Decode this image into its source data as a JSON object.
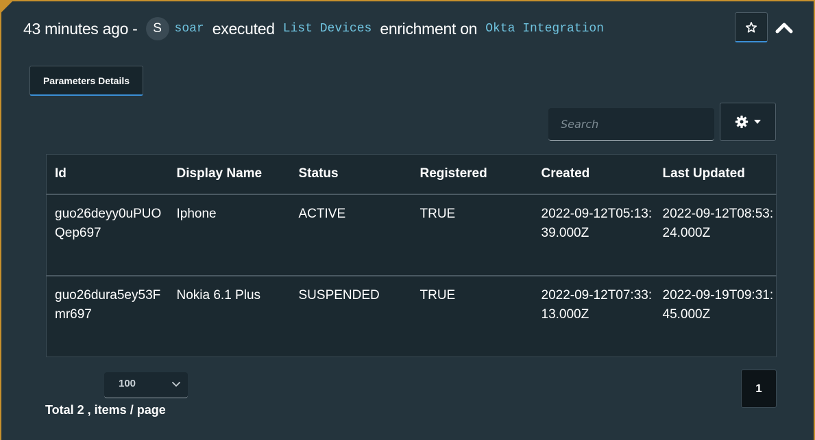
{
  "header": {
    "time_ago": "43 minutes ago -",
    "avatar_initial": "S",
    "user": "soar",
    "verb": "executed",
    "action": "List Devices",
    "middle": "enrichment on",
    "integration": "Okta Integration"
  },
  "icons": {
    "favorite": "star-icon",
    "collapse": "chevron-up-icon",
    "settings": "gear-icon",
    "settings_caret": "caret-down-icon",
    "page_size_caret": "chevron-down-icon"
  },
  "tabs": [
    {
      "label": "Parameters Details",
      "active": true
    }
  ],
  "search": {
    "placeholder": "Search",
    "value": ""
  },
  "table": {
    "columns": [
      "Id",
      "Display Name",
      "Status",
      "Registered",
      "Created",
      "Last Updated"
    ],
    "rows": [
      [
        "guo26deyy0uPUOQep697",
        "Iphone",
        "ACTIVE",
        "TRUE",
        "2022-09-12T05:13:39.000Z",
        "2022-09-12T08:53:24.000Z"
      ],
      [
        "guo26dura5ey53Fmr697",
        "Nokia 6.1 Plus",
        "SUSPENDED",
        "TRUE",
        "2022-09-12T07:33:13.000Z",
        "2022-09-19T09:31:45.000Z"
      ]
    ]
  },
  "pagination": {
    "page_size": "100",
    "total_text": "Total 2 , items / page",
    "current_page": "1"
  },
  "colors": {
    "background": "#24343d",
    "accent_border": "#c8902c",
    "link_mono": "#6fc3df",
    "active_underline": "#3b8fd6"
  }
}
